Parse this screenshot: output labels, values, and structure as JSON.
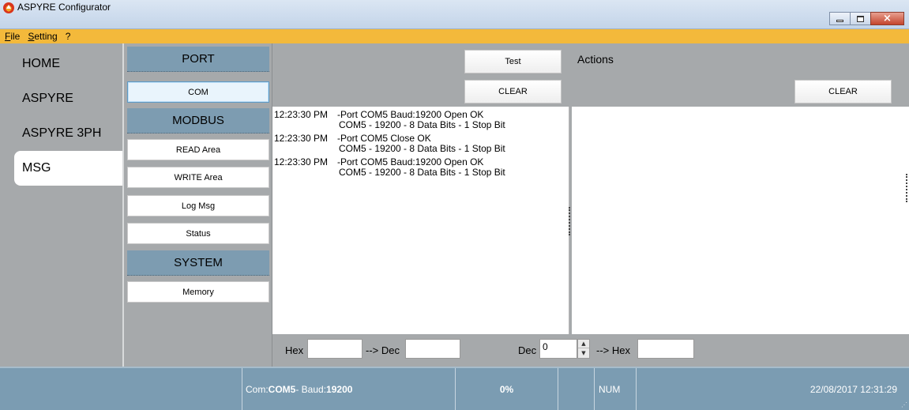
{
  "window": {
    "title": "ASPYRE Configurator",
    "controls": {
      "minimize": "minimize",
      "maximize": "maximize",
      "close": "×"
    }
  },
  "menu": [
    {
      "key": "F",
      "rest": "ile"
    },
    {
      "key": "S",
      "rest": "etting"
    },
    {
      "key": "",
      "rest": "?"
    }
  ],
  "nav": {
    "items": [
      "HOME",
      "ASPYRE",
      "ASPYRE 3PH",
      "MSG"
    ],
    "active": "MSG"
  },
  "sections": {
    "port": {
      "title": "PORT",
      "buttons": [
        "COM"
      ]
    },
    "modbus": {
      "title": "MODBUS",
      "buttons": [
        "READ Area",
        "WRITE Area",
        "Log Msg",
        "Status"
      ]
    },
    "system": {
      "title": "SYSTEM",
      "buttons": [
        "Memory"
      ]
    },
    "selected_button": "COM"
  },
  "toolbar": {
    "test_label": "Test",
    "clear_log_label": "CLEAR",
    "actions_title": "Actions",
    "clear_actions_label": "CLEAR"
  },
  "log": [
    {
      "time": "12:23:30 PM",
      "msg": "-Port COM5 Baud:19200 Open OK",
      "detail": "COM5 - 19200 - 8 Data Bits - 1 Stop Bit"
    },
    {
      "time": "12:23:30 PM",
      "msg": "-Port COM5 Close OK",
      "detail": "COM5 - 19200 - 8 Data Bits - 1 Stop Bit"
    },
    {
      "time": "12:23:30 PM",
      "msg": "-Port COM5 Baud:19200 Open OK",
      "detail": "COM5 - 19200 - 8 Data Bits - 1 Stop Bit"
    }
  ],
  "converter": {
    "hex_label": "Hex",
    "hex_value": "",
    "to_dec_label": "--> Dec",
    "dec_result": "",
    "dec_label": "Dec",
    "dec_value": "0",
    "to_hex_label": "--> Hex",
    "hex_result": ""
  },
  "status": {
    "com_prefix": "Com:",
    "com_port": "COM5",
    "baud_prefix": " - Baud:",
    "baud": "19200",
    "progress": "0%",
    "num": "NUM",
    "datetime": "22/08/2017 12:31:29"
  },
  "colors": {
    "menubar": "#f3b93b",
    "panel_grey": "#a6a9ab",
    "section_blue": "#7d9cb1",
    "statusbar": "#7b9cb2"
  }
}
